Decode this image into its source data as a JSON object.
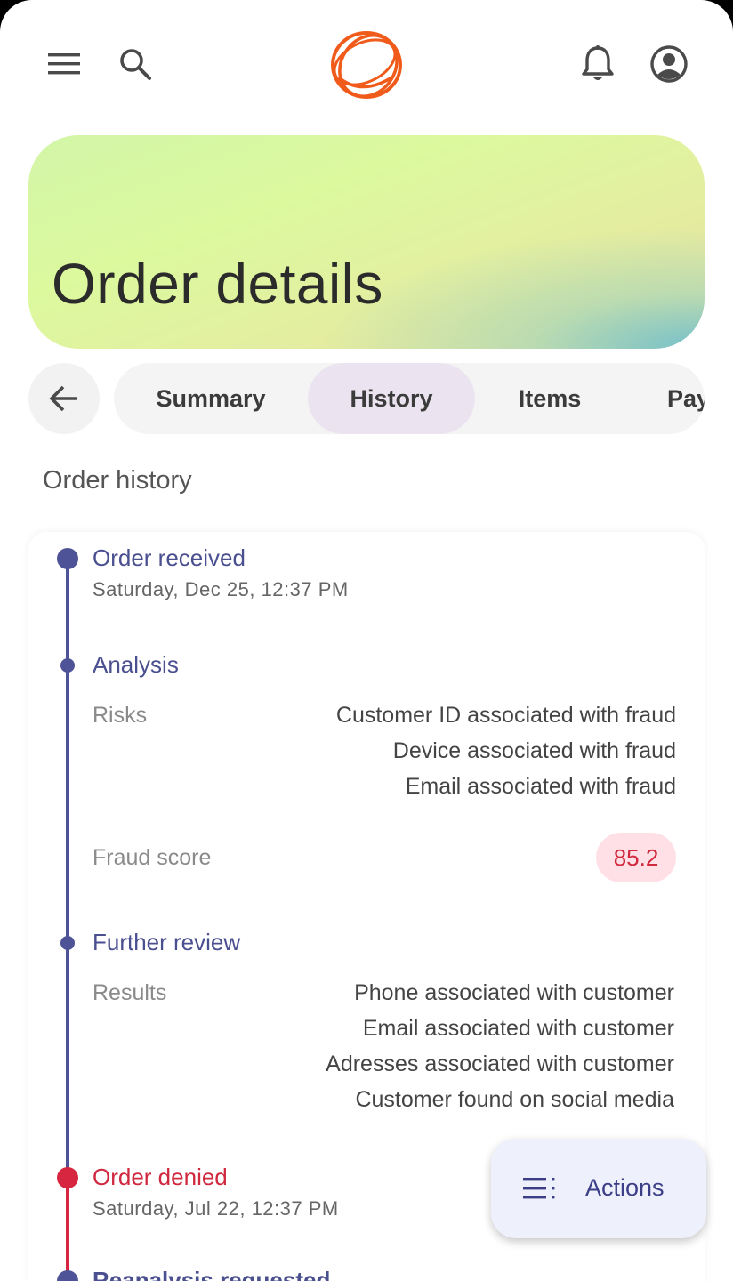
{
  "header": {
    "menu_icon": "menu-icon",
    "search_icon": "search-icon",
    "logo_icon": "orbit-logo-icon",
    "notifications_icon": "bell-icon",
    "account_icon": "account-circle-icon",
    "logo_color": "#f05a1a"
  },
  "hero": {
    "title": "Order details"
  },
  "tabs": {
    "back_icon": "arrow-left-icon",
    "items": [
      {
        "label": "Summary"
      },
      {
        "label": "History"
      },
      {
        "label": "Items"
      },
      {
        "label": "Pay"
      }
    ],
    "active": "History"
  },
  "history": {
    "section_title": "Order history",
    "events": [
      {
        "title": "Order received",
        "date": "Saturday, Dec 25, 12:37 PM"
      },
      {
        "title": "Analysis",
        "risks_label": "Risks",
        "risks": [
          "Customer ID associated with fraud",
          "Device associated with fraud",
          "Email associated with fraud"
        ],
        "score_label": "Fraud score",
        "score": "85.2"
      },
      {
        "title": "Further review",
        "results_label": "Results",
        "results": [
          "Phone associated with customer",
          "Email associated with customer",
          "Adresses associated with customer",
          "Customer found on social media"
        ]
      },
      {
        "title": "Order denied",
        "date": "Saturday, Jul 22, 12:37 PM"
      },
      {
        "title": "Reanalysis requested"
      }
    ]
  },
  "fab": {
    "label": "Actions",
    "icon": "list-actions-icon"
  },
  "colors": {
    "accent": "#4a4f8f",
    "danger": "#d0283f",
    "tab_active_bg": "#ebe4f0",
    "fab_bg": "#eef0fb"
  }
}
